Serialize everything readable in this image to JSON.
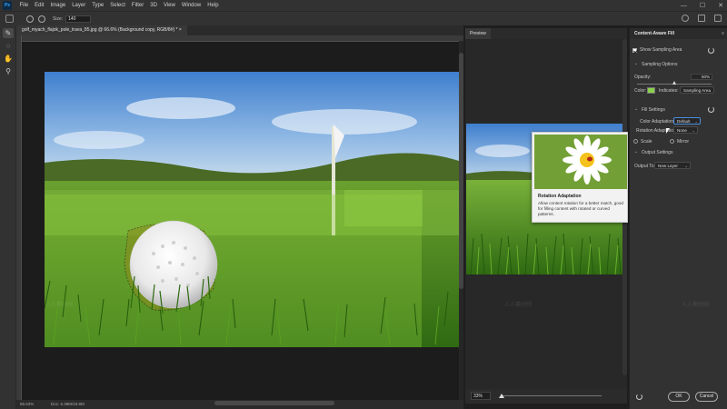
{
  "app": {
    "logo": "Ps"
  },
  "menu": [
    "File",
    "Edit",
    "Image",
    "Layer",
    "Type",
    "Select",
    "Filter",
    "3D",
    "View",
    "Window",
    "Help"
  ],
  "options": {
    "size_label": "Size:",
    "size_value": "140"
  },
  "document": {
    "tab_title": "golf_myach_flajok_pole_trava_85.jpg @ 66.6% (Background copy, RGB/8#) * ×",
    "zoom": "66.63%",
    "doc_size": "Doc: 6.39M/19.8M"
  },
  "preview": {
    "tab_label": "Preview",
    "zoom": "33%"
  },
  "tooltip": {
    "title": "Rotation Adaptation",
    "description": "Allow content rotation for a better match, good for filling content with rotated or curved patterns."
  },
  "panel": {
    "title": "Content-Aware Fill",
    "show_sampling_area": "Show Sampling Area",
    "sampling_options": "Sampling Options",
    "opacity_label": "Opacity:",
    "opacity_value": "50%",
    "opacity_level": 0.5,
    "color_label": "Color:",
    "color_value": "#8bd04a",
    "indicates_label": "Indicates:",
    "indicates_value": "Sampling Area",
    "fill_settings": "Fill Settings",
    "color_adaptation_label": "Color Adaptation:",
    "color_adaptation_value": "Default",
    "rotation_adaptation_label": "Rotation Adaptation:",
    "rotation_adaptation_value": "None",
    "scale_label": "Scale",
    "mirror_label": "Mirror",
    "output_settings": "Output Settings",
    "output_to_label": "Output To:",
    "output_to_value": "New Layer",
    "ok_label": "OK",
    "cancel_label": "Cancel"
  },
  "watermark_text": "人人素材网"
}
